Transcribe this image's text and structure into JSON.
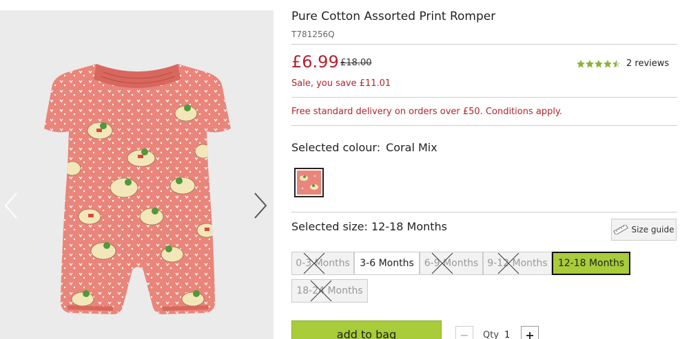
{
  "product": {
    "title": "Pure Cotton Assorted Print Romper",
    "code": "T781256Q",
    "price_now": "£6.99",
    "price_was": "£18.00",
    "sale_text": "Sale, you save £11.01",
    "rating": 4.5,
    "reviews": "2 reviews",
    "delivery_text": "Free standard delivery on orders over £50. Conditions apply."
  },
  "colour": {
    "label": "Selected colour:",
    "value": "Coral Mix",
    "swatch_color": "#e9857a"
  },
  "size": {
    "label": "Selected size:",
    "value": "12-18 Months",
    "guide_label": "Size guide",
    "options": [
      {
        "label": "0-3 Months",
        "state": "unavailable"
      },
      {
        "label": "3-6 Months",
        "state": "available"
      },
      {
        "label": "6-9 Months",
        "state": "unavailable"
      },
      {
        "label": "9-12 Months",
        "state": "unavailable"
      },
      {
        "label": "12-18 Months",
        "state": "selected"
      },
      {
        "label": "18-24 Months",
        "state": "unavailable"
      }
    ]
  },
  "actions": {
    "add_to_bag": "add to bag",
    "qty_label": "Qty",
    "qty_value": "1",
    "minus": "−",
    "plus": "+"
  },
  "colors": {
    "price_red": "#b2232b",
    "accent_green": "#a8cc3a",
    "romper_coral": "#e9857a",
    "gallery_bg": "#ebebeb"
  },
  "icons": {
    "prev": "chevron-left-icon",
    "next": "chevron-right-icon",
    "size_guide": "ruler-icon",
    "star": "star-icon"
  }
}
